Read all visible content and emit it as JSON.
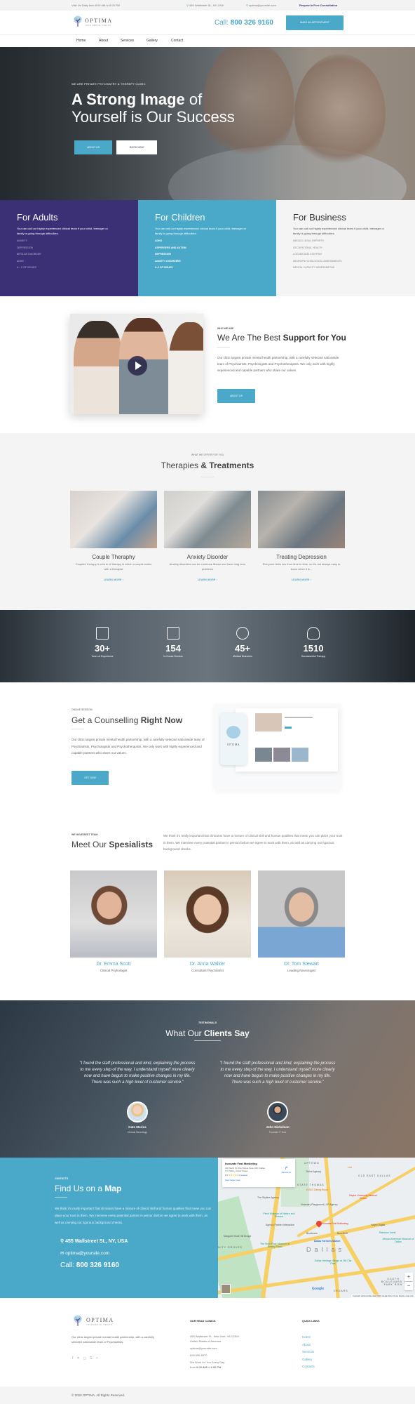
{
  "topbar": {
    "hours": "Visit Us Daily from 8.00 AM to 6.00 PM",
    "address": "455 Wallstreet St., NY, USA",
    "email": "optima@yoursite.com",
    "consultation": "Request a Free Consultation"
  },
  "header": {
    "logo_name": "OPTIMA",
    "logo_tagline": "YOUR MENTAL HEALTH",
    "call_label": "Call:",
    "call_number": "800 326 9160",
    "appointment_button": "MAKE AN APPOINTMENT"
  },
  "nav": [
    "Home",
    "About",
    "Services",
    "Gallery",
    "Contact"
  ],
  "hero": {
    "tag": "WE ARE PRIVATE PSYCHIATRY & THEREPY CLINIC",
    "title_bold": "A Strong Image",
    "title_rest": " of",
    "title_line2": "Yourself is Our Success",
    "about_button": "ABOUT US",
    "book_button": "BOOK NOW"
  },
  "audience": {
    "adults": {
      "title": "For Adults",
      "text": "You can call our highly experienced clinical team if your child, teenager or family is going through difficulties.",
      "items": [
        "ANXIETY",
        "DEPRESSION",
        "BIPOLAR DISORDER",
        "ADHD",
        "A – Z OF ISSUES"
      ]
    },
    "children": {
      "title": "For Children",
      "text": "You can call our highly experienced clinical team if your child, teenager or family is going through difficulties.",
      "items": [
        "ADHD",
        "ASPERGERS AND AUTISM",
        "DEPRESSION",
        "ANXIETY DISORDERS",
        "A-Z OF ISSUES"
      ]
    },
    "business": {
      "title": "For Business",
      "text": "You can call our highly experienced clinical team if your child, teenager or family is going through difficulties.",
      "items": [
        "MEDICO LEGAL REPORTS",
        "OCCUPATIONAL HEALTH",
        "LOCUMS AND STAFFING",
        "NEUROPSYCHOLOGICAL ASSESSMENTS",
        "MENTAL CAPACITY ASSESSMETNS"
      ]
    }
  },
  "about": {
    "tag": "WHO WE ARE",
    "title_light": "We Are The Best ",
    "title_bold": "Support for You",
    "text": "Our clinic largest private mental health partnership, with a carefully selected nationwide team of Psychiatrists, Psychologists and Psychotherapists. We only work with highly experienced and capable partners who share our values.",
    "button": "ABOUT US"
  },
  "therapies": {
    "tag": "WHAT WE OFFER FOR YOU",
    "title_light": "Therapies ",
    "title_bold": "& Treatments",
    "cards": [
      {
        "title": "Couple Theraphy",
        "desc": "Couples' therapy is a form of therapy in which a couple works with a therapist",
        "link": "LEARN MORE ›"
      },
      {
        "title": "Anxiety Disorder",
        "desc": "Anxiety disorders can be a serious illness and have long term problems",
        "link": "LEARN MORE ›"
      },
      {
        "title": "Treating Depression",
        "desc": "Everyone feels low from time to time, so it's not always easy to know when it is...",
        "link": "LEARN MORE ›"
      }
    ]
  },
  "stats": [
    {
      "icon": "calendar-icon",
      "value": "30+",
      "label": "Years of Experience"
    },
    {
      "icon": "clipboard-icon",
      "value": "154",
      "label": "In-House Doctors"
    },
    {
      "icon": "people-icon",
      "value": "45+",
      "label": "Medical Branches"
    },
    {
      "icon": "heart-person-icon",
      "value": "1510",
      "label": "Successesful Therapy"
    }
  ],
  "counselling": {
    "tag": "ONLINE SESSION",
    "title_light": "Get a Counselling ",
    "title_bold": "Right Now",
    "text": "Our clinic largest private mental health partnership, with a carefully selected nationwide team of Psychiatrists, Psychologists and Psychotherapists. We only work with highly experienced and capable partners who share our values.",
    "button": "GET NOW"
  },
  "specialists": {
    "tag": "WE HAVE BEST TEAM",
    "title_light": "Meet Our ",
    "title_bold": "Spesialists",
    "text": "We think it's really important that clinicians have a mixture of clinical skill and human qualities that mean you can place your trust in them. We interview every potential partner in person before we agree to work with them, as well as carrying out rigorous background checks.",
    "doctors": [
      {
        "name": "Dr. Emma Scott",
        "role": "Clinical Psyhologist"
      },
      {
        "name": "Dr. Anna Walker",
        "role": "Consultant Psychiatrist"
      },
      {
        "name": "Dr. Tom Stewart",
        "role": "Leading Neurologist"
      }
    ]
  },
  "testimonials": {
    "tag": "TESTIMONIALS",
    "title_light": "What Our ",
    "title_bold": "Clients Say",
    "items": [
      {
        "quote": "\"I found the staff professional and kind, explaining the process to me every step of the way. I understand myself more clearly now and have begun to make positive changes in my life. There was such a high level of customer service.\"",
        "name": "Kate Moriss",
        "role": "Clinical Neurology"
      },
      {
        "quote": "\"I found the staff professional and kind, explaining the process to me every step of the way. I understand myself more clearly now and have begun to make positive changes in my life. There was such a high level of customer service.\"",
        "name": "John Nickelson",
        "role": "Founder IT Hub"
      }
    ]
  },
  "contacts": {
    "tag": "CONTACTS",
    "title_light": "Find Us on a ",
    "title_bold": "Map",
    "text": "We think it's really important that clinicians have a mixture of clinical skill and human qualities that mean you can place your trust in them. We interview every potential partner in person before we agree to work with them, as well as carrying out rigorous background checks.",
    "address": "455 Wallstreet St., NY, USA",
    "email": "optima@yoursite.com",
    "call_label": "Call: ",
    "call_number": "800 326 9160"
  },
  "map": {
    "place_name": "Innovate Fast Marketing",
    "place_address": "400 North St. Paul Street Suite 920, Dallas, TX 75201, United States",
    "rating": "5.0",
    "stars": "★★★★★",
    "reviews": "2 reviews",
    "directions": "Directions",
    "larger_map": "View larger map",
    "labels": [
      "UPTOWN",
      "STATE THOMAS",
      "OLD EAST DALLAS",
      "Thrive Agency",
      "The Skyline Agency",
      "Visionary Playground | VP Agency",
      "Perot Museum of Nature and Science",
      "Agency Partner Interactive",
      "Innovate Fast Marketing",
      "Valynt Digital",
      "Bluebeam",
      "BuzzShift",
      "Dallas Farmers Market",
      "Baylor University Medical Center",
      "Rainbow Vomit",
      "African American Museum of Dallas",
      "The Sixth Floor Museum at Dealey Plaza",
      "Dallas Heritage Village at Old City Park",
      "Margaret Hunt Hill Bridge",
      "NITY GROVES",
      "SOUTH BOULEVARD / PARK ROW",
      "CEDARS",
      "Lou",
      "KOKO Dining Room"
    ],
    "city": "Dallas",
    "footer": "Keyboard shortcuts   Map data ©2022 Google   Terms of Use   Report a map error"
  },
  "footer": {
    "logo_name": "OPTIMA",
    "logo_tagline": "YOUR MENTAL HEALTH",
    "about_text": "Our clinic largest private mental health partnership, with a carefully selected nationwide team of Psychiatrists.",
    "social": [
      "facebook-icon",
      "twitter-icon",
      "instagram-icon",
      "google-plus-icon"
    ],
    "clinic_heading": "OUR HEAD CLINICK",
    "clinic_address1": "455 Wallstreet St., New York, VA 12364",
    "clinic_address2": "United States of America",
    "clinic_email": "optima@yoursite.com",
    "clinic_phone": "826 696 8370",
    "hours_line1": "We Work for You Every Day",
    "hours_from": "from ",
    "hours_start": "8.00 AM",
    "hours_to": " to ",
    "hours_end": "6.00 PM",
    "links_heading": "QUICK LINKS",
    "links": [
      "Home",
      "About",
      "Services",
      "Gallery",
      "Contacts"
    ],
    "copyright": "© 2020 OPTIMA. All Rights Reserved."
  },
  "colors": {
    "accent": "#4aa8c8",
    "brand_purple": "#3b2f75",
    "light_bg": "#f4f4f4"
  }
}
